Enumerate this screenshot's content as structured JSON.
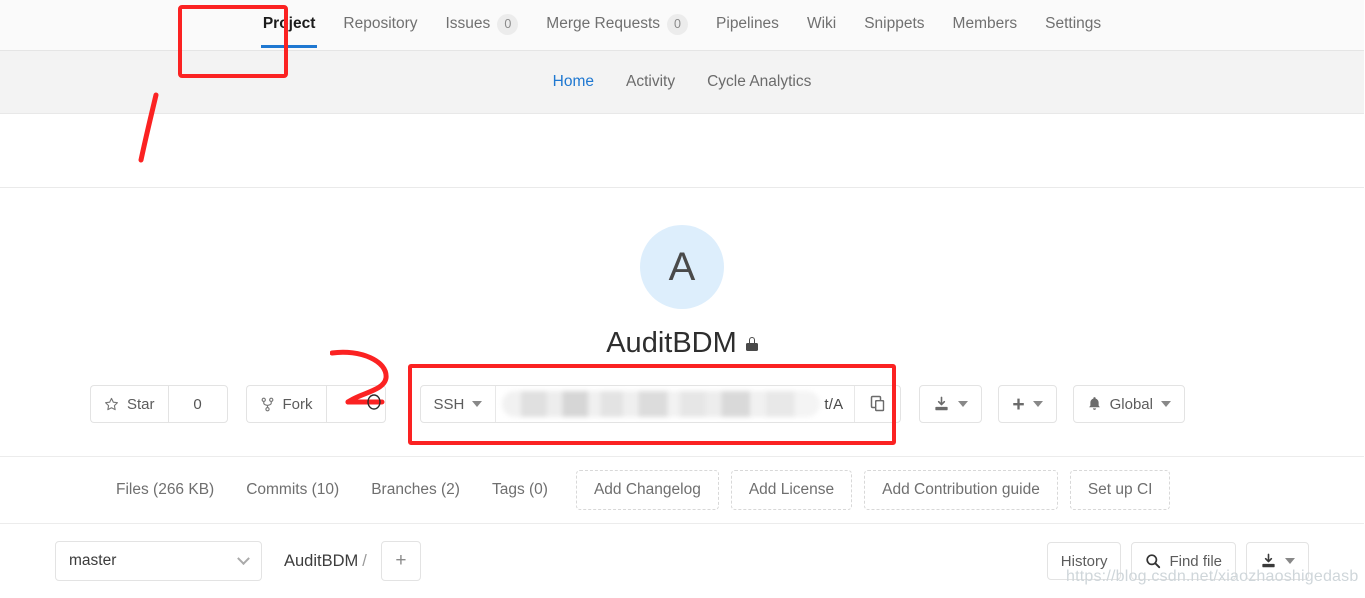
{
  "top_nav": {
    "items": [
      {
        "label": "Project",
        "badge": null,
        "active": true
      },
      {
        "label": "Repository",
        "badge": null,
        "active": false
      },
      {
        "label": "Issues",
        "badge": "0",
        "active": false
      },
      {
        "label": "Merge Requests",
        "badge": "0",
        "active": false
      },
      {
        "label": "Pipelines",
        "badge": null,
        "active": false
      },
      {
        "label": "Wiki",
        "badge": null,
        "active": false
      },
      {
        "label": "Snippets",
        "badge": null,
        "active": false
      },
      {
        "label": "Members",
        "badge": null,
        "active": false
      },
      {
        "label": "Settings",
        "badge": null,
        "active": false
      }
    ]
  },
  "sub_nav": {
    "items": [
      {
        "label": "Home",
        "active": true
      },
      {
        "label": "Activity",
        "active": false
      },
      {
        "label": "Cycle Analytics",
        "active": false
      }
    ]
  },
  "project": {
    "avatar_initial": "A",
    "title": "AuditBDM",
    "visibility_icon": "lock-icon"
  },
  "actions": {
    "star_label": "Star",
    "star_count": "0",
    "fork_label": "Fork",
    "fork_count": "",
    "clone": {
      "protocol": "SSH",
      "url_visible_tail": "t/A",
      "copy_icon": "copy-icon"
    },
    "download_icon": "download-icon",
    "plus_icon": "plus-icon",
    "notification_icon": "bell-icon",
    "notification_label": "Global"
  },
  "stats": {
    "links": [
      {
        "label": "Files (266 KB)"
      },
      {
        "label": "Commits (10)"
      },
      {
        "label": "Branches (2)"
      },
      {
        "label": "Tags (0)"
      }
    ],
    "quick_actions": [
      {
        "label": "Add Changelog"
      },
      {
        "label": "Add License"
      },
      {
        "label": "Add Contribution guide"
      },
      {
        "label": "Set up CI"
      }
    ]
  },
  "file_toolbar": {
    "branch": "master",
    "breadcrumb_root": "AuditBDM",
    "breadcrumb_separator": "/",
    "add_label": "+",
    "history_label": "History",
    "find_file_label": "Find file",
    "download_icon": "download-icon"
  },
  "watermark": {
    "text": "https://blog.csdn.net/xiaozhaoshigedasb"
  },
  "colors": {
    "accent_blue": "#1f78d1",
    "annotation_red": "#fb2222",
    "avatar_bg": "#ddeefc",
    "nav_bg": "#fafafa",
    "subnav_bg": "#f3f3f3"
  }
}
